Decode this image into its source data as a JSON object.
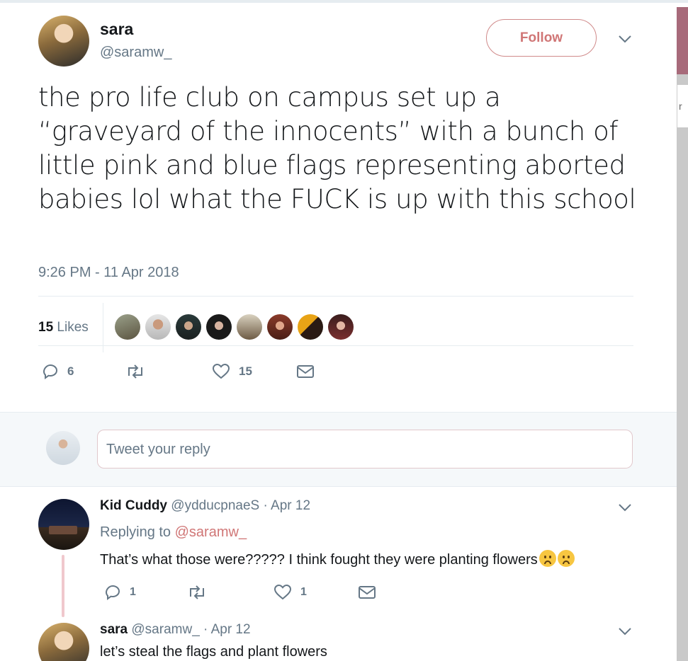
{
  "tweet": {
    "author_name": "sara",
    "author_handle": "@saramw_",
    "follow_label": "Follow",
    "text": "the pro life club on campus set up a “graveyard of the innocents” with a bunch of little pink and blue flags representing aborted babies lol what the FUCK is up with this school",
    "timestamp": "9:26 PM - 11 Apr 2018",
    "likes_count": "15",
    "likes_label": "Likes",
    "likers": [
      "liker-1",
      "liker-2",
      "liker-3",
      "liker-4",
      "liker-5",
      "liker-6",
      "liker-7",
      "liker-8"
    ],
    "actions": {
      "replies": "6",
      "retweets": "",
      "likes": "15"
    }
  },
  "reply_box": {
    "placeholder": "Tweet your reply"
  },
  "replies": [
    {
      "name": "Kid Cuddy",
      "handle": "@ydducpnaeS · Apr 12",
      "replying_prefix": "Replying to",
      "replying_to": "@saramw_",
      "text": "That’s what those were????? I think fought they were planting flowers",
      "actions": {
        "replies": "1",
        "likes": "1"
      }
    },
    {
      "name": "sara",
      "handle": "@saramw_ · Apr 12",
      "text": "let’s steal the flags and plant flowers"
    }
  ],
  "colors": {
    "accent": "#d07676",
    "muted": "#657786",
    "divider": "#e6ecf0"
  },
  "icons": [
    "chevron-down-icon",
    "reply-icon",
    "retweet-icon",
    "heart-icon",
    "message-icon"
  ]
}
